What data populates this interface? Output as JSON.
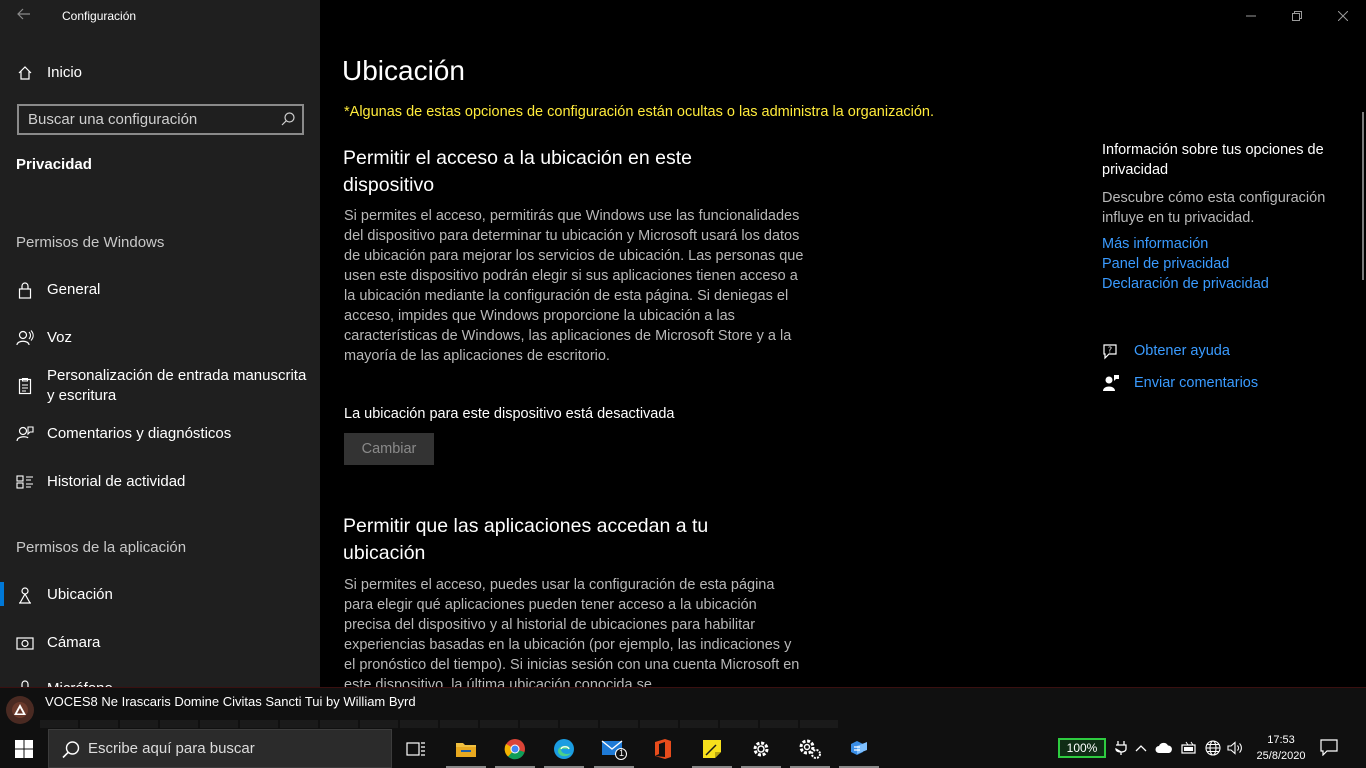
{
  "window": {
    "title": "Configuración",
    "back_icon": "arrow-left-icon",
    "controls": [
      "minimize-icon",
      "restore-icon",
      "close-icon"
    ]
  },
  "sidebar": {
    "home_label": "Inicio",
    "search_placeholder": "Buscar una configuración",
    "section_title": "Privacidad",
    "windows_permissions_heading": "Permisos de Windows",
    "windows_items": [
      {
        "label": "General",
        "icon": "lock-icon"
      },
      {
        "label": "Voz",
        "icon": "speech-icon"
      },
      {
        "label": "Personalización de entrada manuscrita y escritura",
        "icon": "clipboard-icon"
      },
      {
        "label": "Comentarios y diagnósticos",
        "icon": "feedback-icon"
      },
      {
        "label": "Historial de actividad",
        "icon": "timeline-icon"
      }
    ],
    "app_permissions_heading": "Permisos de la aplicación",
    "app_items": [
      {
        "label": "Ubicación",
        "icon": "location-icon",
        "active": true
      },
      {
        "label": "Cámara",
        "icon": "camera-icon"
      },
      {
        "label": "Micrófono",
        "icon": "microphone-icon"
      }
    ]
  },
  "main": {
    "title": "Ubicación",
    "org_note": "*Algunas de estas opciones de configuración están ocultas o las administra la organización.",
    "section1": {
      "title": "Permitir el acceso a la ubicación en este dispositivo",
      "body": "Si permites el acceso, permitirás que Windows use las funcionalidades del dispositivo para determinar tu ubicación y Microsoft usará los datos de ubicación para mejorar los servicios de ubicación. Las personas que usen este dispositivo podrán elegir si sus aplicaciones tienen acceso a la ubicación mediante la configuración de esta página. Si deniegas el acceso, impides que Windows proporcione la ubicación a las características de Windows, las aplicaciones de Microsoft Store y a la mayoría de las aplicaciones de escritorio.",
      "status": "La ubicación para este dispositivo está desactivada",
      "button_label": "Cambiar"
    },
    "section2": {
      "title": "Permitir que las aplicaciones accedan a tu ubicación",
      "body": "Si permites el acceso, puedes usar la configuración de esta página para elegir qué aplicaciones pueden tener acceso a la ubicación precisa del dispositivo y al historial de ubicaciones para habilitar experiencias basadas en la ubicación (por ejemplo, las indicaciones y el pronóstico del tiempo). Si inicias sesión con una cuenta Microsoft en este dispositivo, la última ubicación conocida se"
    },
    "info": {
      "title": "Información sobre tus opciones de privacidad",
      "description": "Descubre cómo esta configuración influye en tu privacidad.",
      "links": [
        "Más información",
        "Panel de privacidad",
        "Declaración de privacidad"
      ]
    },
    "help": {
      "get_help": "Obtener ayuda",
      "feedback": "Enviar comentarios"
    }
  },
  "media": {
    "now_playing": "VOCES8 Ne Irascaris Domine  Civitas Sancti Tui by William Byrd"
  },
  "taskbar": {
    "search_placeholder": "Escribe aquí para buscar",
    "apps": [
      "task-view-icon",
      "file-explorer-icon",
      "chrome-icon",
      "edge-icon",
      "mail-icon",
      "office-icon",
      "sticky-notes-icon",
      "settings-icon",
      "settings-gear-icon",
      "app-icon"
    ],
    "mail_badge": "1",
    "battery": "100%",
    "time": "17:53",
    "date": "25/8/2020"
  },
  "colors": {
    "accent": "#0078d7",
    "link": "#3a9bff",
    "warning": "#ffeb3b",
    "battery": "#2ecc40"
  }
}
